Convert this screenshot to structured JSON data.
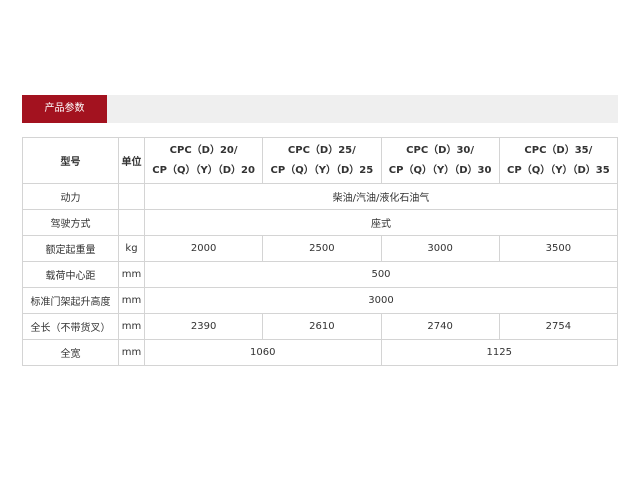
{
  "section": {
    "tab_label": "产品参数"
  },
  "table": {
    "header": {
      "model_label": "型号",
      "unit_label": "单位",
      "models": [
        {
          "line1": "CPC（D）20/",
          "line2": "CP（Q）（Y）（D）20"
        },
        {
          "line1": "CPC（D）25/",
          "line2": "CP（Q）（Y）（D）25"
        },
        {
          "line1": "CPC（D）30/",
          "line2": "CP（Q）（Y）（D）30"
        },
        {
          "line1": "CPC（D）35/",
          "line2": "CP（Q）（Y）（D）35"
        }
      ]
    },
    "rows": [
      {
        "label": "动力",
        "unit": "",
        "value": "柴油/汽油/液化石油气"
      },
      {
        "label": "驾驶方式",
        "unit": "",
        "value": "座式"
      },
      {
        "label": "额定起重量",
        "unit": "kg",
        "values": [
          "2000",
          "2500",
          "3000",
          "3500"
        ]
      },
      {
        "label": "载荷中心距",
        "unit": "mm",
        "value": "500"
      },
      {
        "label": "标准门架起升高度",
        "unit": "mm",
        "value": "3000"
      },
      {
        "label": "全长（不带货叉）",
        "unit": "mm",
        "values": [
          "2390",
          "2610",
          "2740",
          "2754"
        ]
      },
      {
        "label": "全宽",
        "unit": "mm",
        "values": [
          "1060",
          "1125"
        ]
      }
    ]
  }
}
